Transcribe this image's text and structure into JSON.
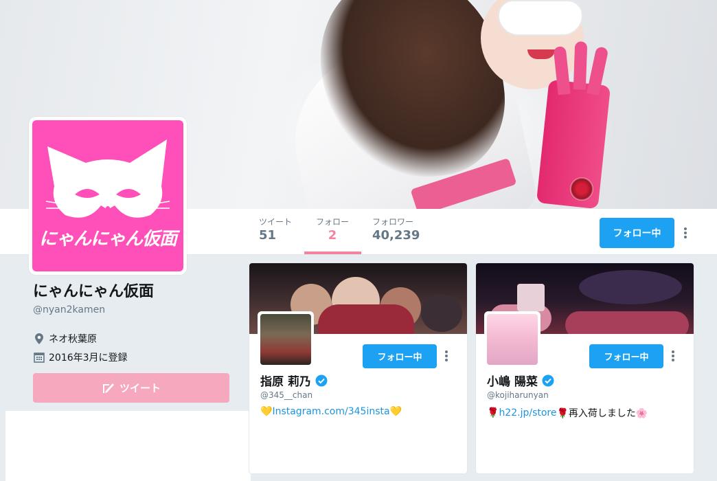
{
  "profile": {
    "name": "にゃんにゃん仮面",
    "handle": "@nyan2kamen",
    "location": "ネオ秋葉原",
    "joined": "2016年3月に登録",
    "avatar_text": "にゃんにゃん仮面",
    "tweet_button": "ツイート"
  },
  "nav": {
    "stats": [
      {
        "label": "ツイート",
        "value": "51"
      },
      {
        "label": "フォロー",
        "value": "2"
      },
      {
        "label": "フォロワー",
        "value": "40,239"
      }
    ],
    "follow_button": "フォロー中"
  },
  "cards": [
    {
      "name": "指原 莉乃",
      "handle": "@345__chan",
      "bio_prefix": "💛",
      "bio_link": "Instagram.com/345insta",
      "bio_suffix": "💛",
      "follow_button": "フォロー中"
    },
    {
      "name": "小嶋 陽菜",
      "handle": "@kojiharunyan",
      "bio_prefix": "🌹",
      "bio_link": "h22.jp/store",
      "bio_suffix": "🌹再入荷しました🌸",
      "follow_button": "フォロー中"
    }
  ],
  "colors": {
    "accent": "#f2849e",
    "follow_blue": "#1da1f2",
    "avatar_pink": "#ff4fb8",
    "tweet_button": "#f6a8bf"
  },
  "icons": {
    "location": "map-pin-icon",
    "joined": "calendar-icon",
    "tweet": "compose-icon",
    "verified": "verified-badge-icon",
    "more": "more-vertical-icon"
  }
}
